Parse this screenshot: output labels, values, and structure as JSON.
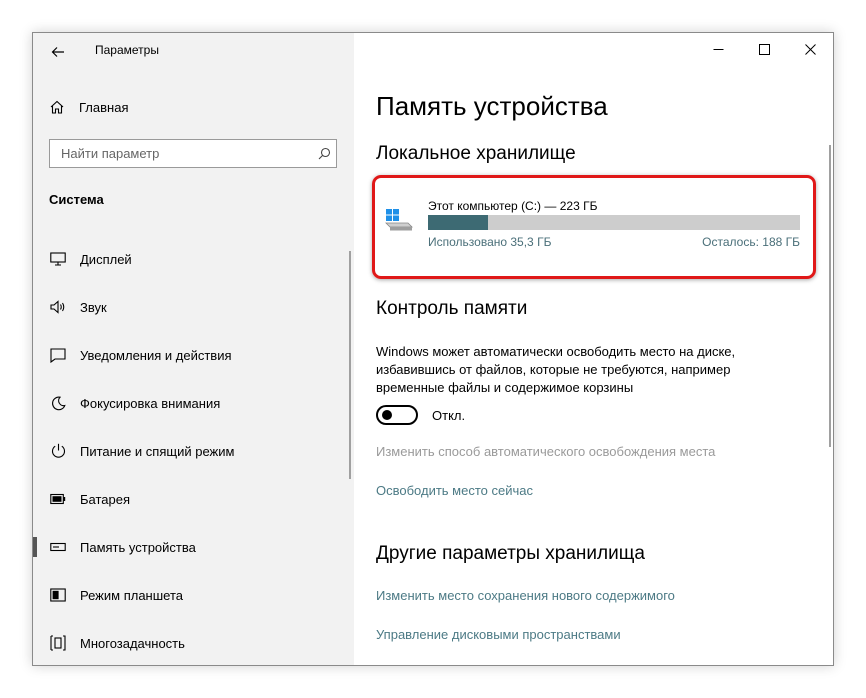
{
  "window": {
    "title": "Параметры"
  },
  "sidebar": {
    "home_label": "Главная",
    "search_placeholder": "Найти параметр",
    "section_title": "Система",
    "items": [
      {
        "label": "Дисплей",
        "icon": "display-icon",
        "active": false
      },
      {
        "label": "Звук",
        "icon": "sound-icon",
        "active": false
      },
      {
        "label": "Уведомления и действия",
        "icon": "notifications-icon",
        "active": false
      },
      {
        "label": "Фокусировка внимания",
        "icon": "focus-moon-icon",
        "active": false
      },
      {
        "label": "Питание и спящий режим",
        "icon": "power-icon",
        "active": false
      },
      {
        "label": "Батарея",
        "icon": "battery-icon",
        "active": false
      },
      {
        "label": "Память устройства",
        "icon": "storage-icon",
        "active": true
      },
      {
        "label": "Режим планшета",
        "icon": "tablet-icon",
        "active": false
      },
      {
        "label": "Многозадачность",
        "icon": "multitasking-icon",
        "active": false
      }
    ]
  },
  "main": {
    "page_title": "Память устройства",
    "local_storage_heading": "Локальное хранилище",
    "drive": {
      "name": "Этот компьютер (C:) — 223 ГБ",
      "used_label": "Использовано 35,3 ГБ",
      "free_label": "Осталось: 188 ГБ",
      "used_fraction": 0.16
    },
    "storage_sense_heading": "Контроль памяти",
    "storage_sense_description": "Windows может автоматически освободить место на диске, избавившись от файлов, которые не требуются, например временные файлы и содержимое корзины",
    "toggle_label": "Откл.",
    "toggle_on": false,
    "change_auto_free_link": "Изменить способ автоматического освобождения места",
    "free_now_link": "Освободить место сейчас",
    "other_heading": "Другие параметры хранилища",
    "change_save_location_link": "Изменить место сохранения нового содержимого",
    "manage_spaces_link": "Управление дисковыми пространствами"
  },
  "colors": {
    "accent_link": "#4c7a85",
    "usage_bar_fill": "#3d6a73",
    "usage_bar_track": "#cdcdcd",
    "highlight_outline": "#e01818"
  }
}
